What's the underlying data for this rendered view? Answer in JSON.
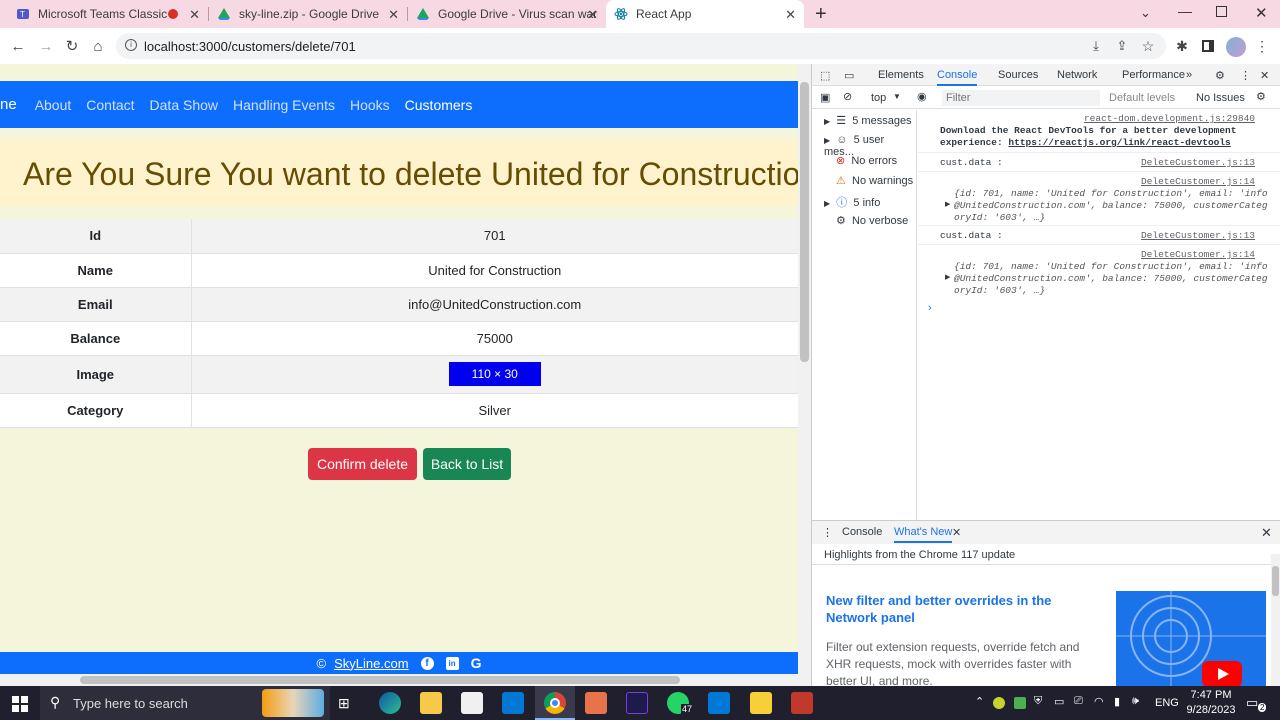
{
  "browser": {
    "tabs": [
      {
        "title": "Microsoft Teams Classic",
        "icon": "teams-icon",
        "color": "#5059c9"
      },
      {
        "title": "sky-line.zip - Google Drive",
        "icon": "google-drive-icon",
        "color": "#1fa463"
      },
      {
        "title": "Google Drive - Virus scan warnin",
        "icon": "google-drive-icon",
        "color": "#1fa463"
      },
      {
        "title": "React App",
        "icon": "react-icon",
        "color": "#0a7ea4"
      }
    ],
    "url": "localhost:3000/customers/delete/701"
  },
  "app": {
    "brand_fragment": "ne",
    "nav": [
      "About",
      "Contact",
      "Data Show",
      "Handling Events",
      "Hooks",
      "Customers"
    ],
    "heading": "Are You Sure You want to delete United for Construction",
    "details": [
      {
        "label": "Id",
        "value": "701"
      },
      {
        "label": "Name",
        "value": "United for Construction"
      },
      {
        "label": "Email",
        "value": "info@UnitedConstruction.com"
      },
      {
        "label": "Balance",
        "value": "75000"
      },
      {
        "label": "Image",
        "value": "110 × 30"
      },
      {
        "label": "Category",
        "value": "Silver"
      }
    ],
    "confirm_label": "Confirm delete",
    "back_label": "Back to List",
    "footer_copy": "©",
    "footer_link": "SkyLine.com",
    "colors": {
      "primary": "#0d6efd",
      "danger": "#dc3545",
      "success": "#198754",
      "warning_bg": "#fff3cd",
      "page_bg": "#f5f5dc"
    }
  },
  "devtools": {
    "tabs": [
      "Elements",
      "Console",
      "Sources",
      "Network",
      "Performance"
    ],
    "context": "top",
    "filter_placeholder": "Filter",
    "levels": "Default levels",
    "issues": "No Issues",
    "sidebar": [
      "5 messages",
      "5 user mes...",
      "No errors",
      "No warnings",
      "5 info",
      "No verbose"
    ],
    "log_source_1": "react-dom.development.js:29840",
    "log_msg_1a": "Download the React DevTools for a better development",
    "log_msg_1b": "experience:",
    "log_link": "https://reactjs.org/link/react-devtools",
    "log_label": "cust.data :",
    "src_13": "DeleteCustomer.js:13",
    "src_14": "DeleteCustomer.js:14",
    "obj_line1": "{id: 701, name: 'United for Construction', email: 'info",
    "obj_line2": "@UnitedConstruction.com', balance: 75000, customerCateg",
    "obj_line3": "oryId: '603', …}",
    "drawer_tabs": [
      "Console",
      "What's New"
    ],
    "drawer_subtitle": "Highlights from the Chrome 117 update",
    "drawer_title": "New filter and better overrides in the Network panel",
    "drawer_body": "Filter out extension requests, override fetch and XHR requests, mock with overrides faster with better UI, and more."
  },
  "taskbar": {
    "search_placeholder": "Type here to search",
    "lang": "ENG",
    "time": "7:47 PM",
    "date": "9/28/2023",
    "badge": "47",
    "notif": "2"
  }
}
